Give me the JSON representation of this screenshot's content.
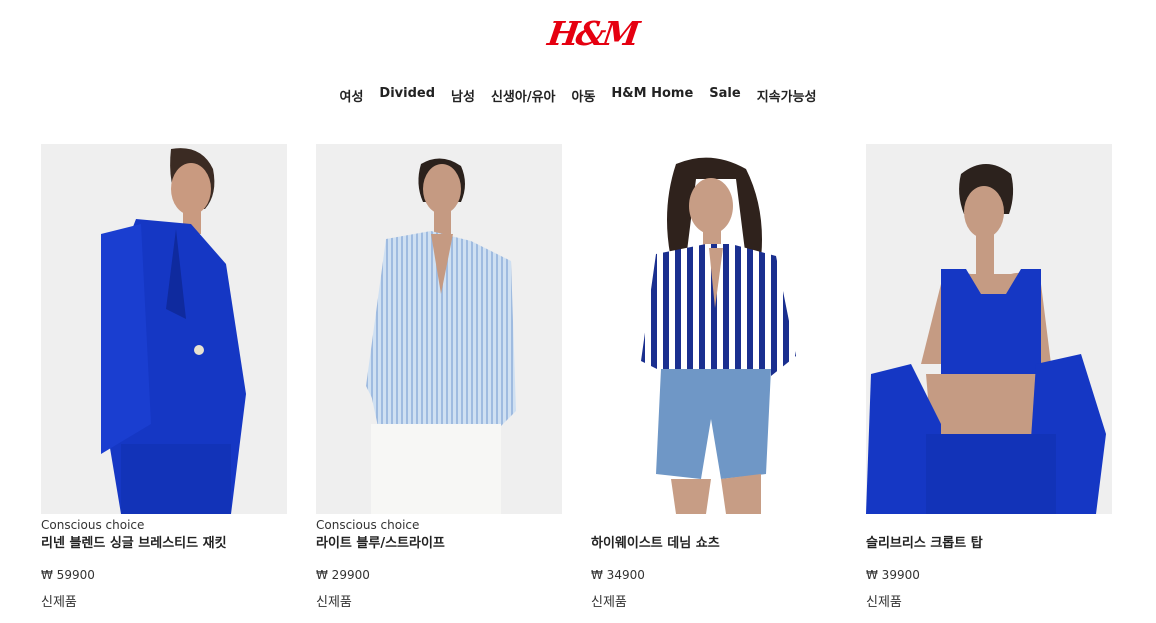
{
  "brand": {
    "logo_text": "H&M",
    "color": "#e50010"
  },
  "nav": {
    "items": [
      {
        "label": "여성"
      },
      {
        "label": "Divided"
      },
      {
        "label": "남성"
      },
      {
        "label": "신생아/유아"
      },
      {
        "label": "아동"
      },
      {
        "label": "H&M Home"
      },
      {
        "label": "Sale"
      },
      {
        "label": "지속가능성"
      }
    ]
  },
  "products": [
    {
      "label": "Conscious choice",
      "name": "리넨 블렌드 싱글 브레스티드 재킷",
      "price": "₩ 59900",
      "badge": "신제품",
      "image": "model in cobalt blue linen blazer"
    },
    {
      "label": "Conscious choice",
      "name": "라이트 블루/스트라이프",
      "price": "₩ 29900",
      "badge": "신제품",
      "image": "model in light blue striped shirt"
    },
    {
      "label": "",
      "name": "하이웨이스트 데님 쇼츠",
      "price": "₩ 34900",
      "badge": "신제품",
      "image": "model in denim shorts and striped shirt"
    },
    {
      "label": "",
      "name": "슬리브리스 크롭트 탑",
      "price": "₩ 39900",
      "badge": "신제품",
      "image": "model in blue cropped tank top"
    }
  ],
  "colors": {
    "cobalt": "#1537c4",
    "accent": "#e50010"
  }
}
